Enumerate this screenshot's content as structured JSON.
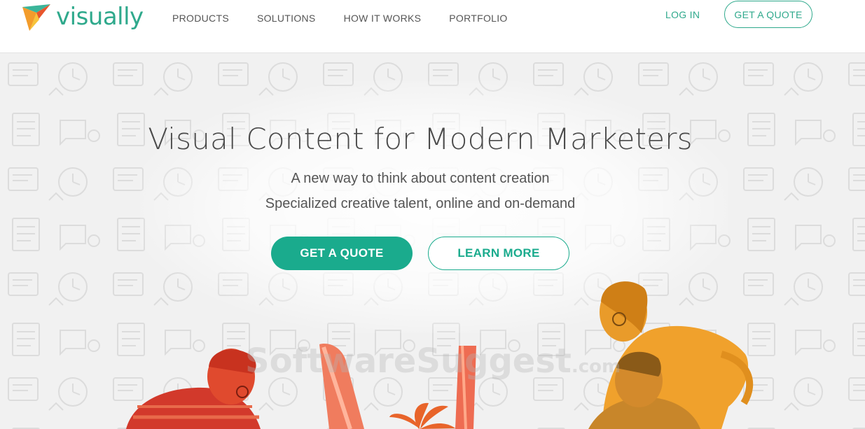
{
  "brand": {
    "name": "visually",
    "accent": "#2fa98c",
    "button": "#1aab8d"
  },
  "nav": {
    "items": [
      {
        "label": "PRODUCTS"
      },
      {
        "label": "SOLUTIONS"
      },
      {
        "label": "HOW IT WORKS"
      },
      {
        "label": "PORTFOLIO"
      }
    ],
    "login_label": "LOG IN",
    "quote_label": "GET A QUOTE"
  },
  "hero": {
    "title": "Visual Content for Modern Marketers",
    "subtitle_1": "A new way to think about content creation",
    "subtitle_2": "Specialized creative talent, online and on-demand",
    "primary_button": "GET A QUOTE",
    "secondary_button": "LEARN MORE"
  },
  "watermark": {
    "main": "SoftwareSuggest",
    "suffix": ".com"
  }
}
